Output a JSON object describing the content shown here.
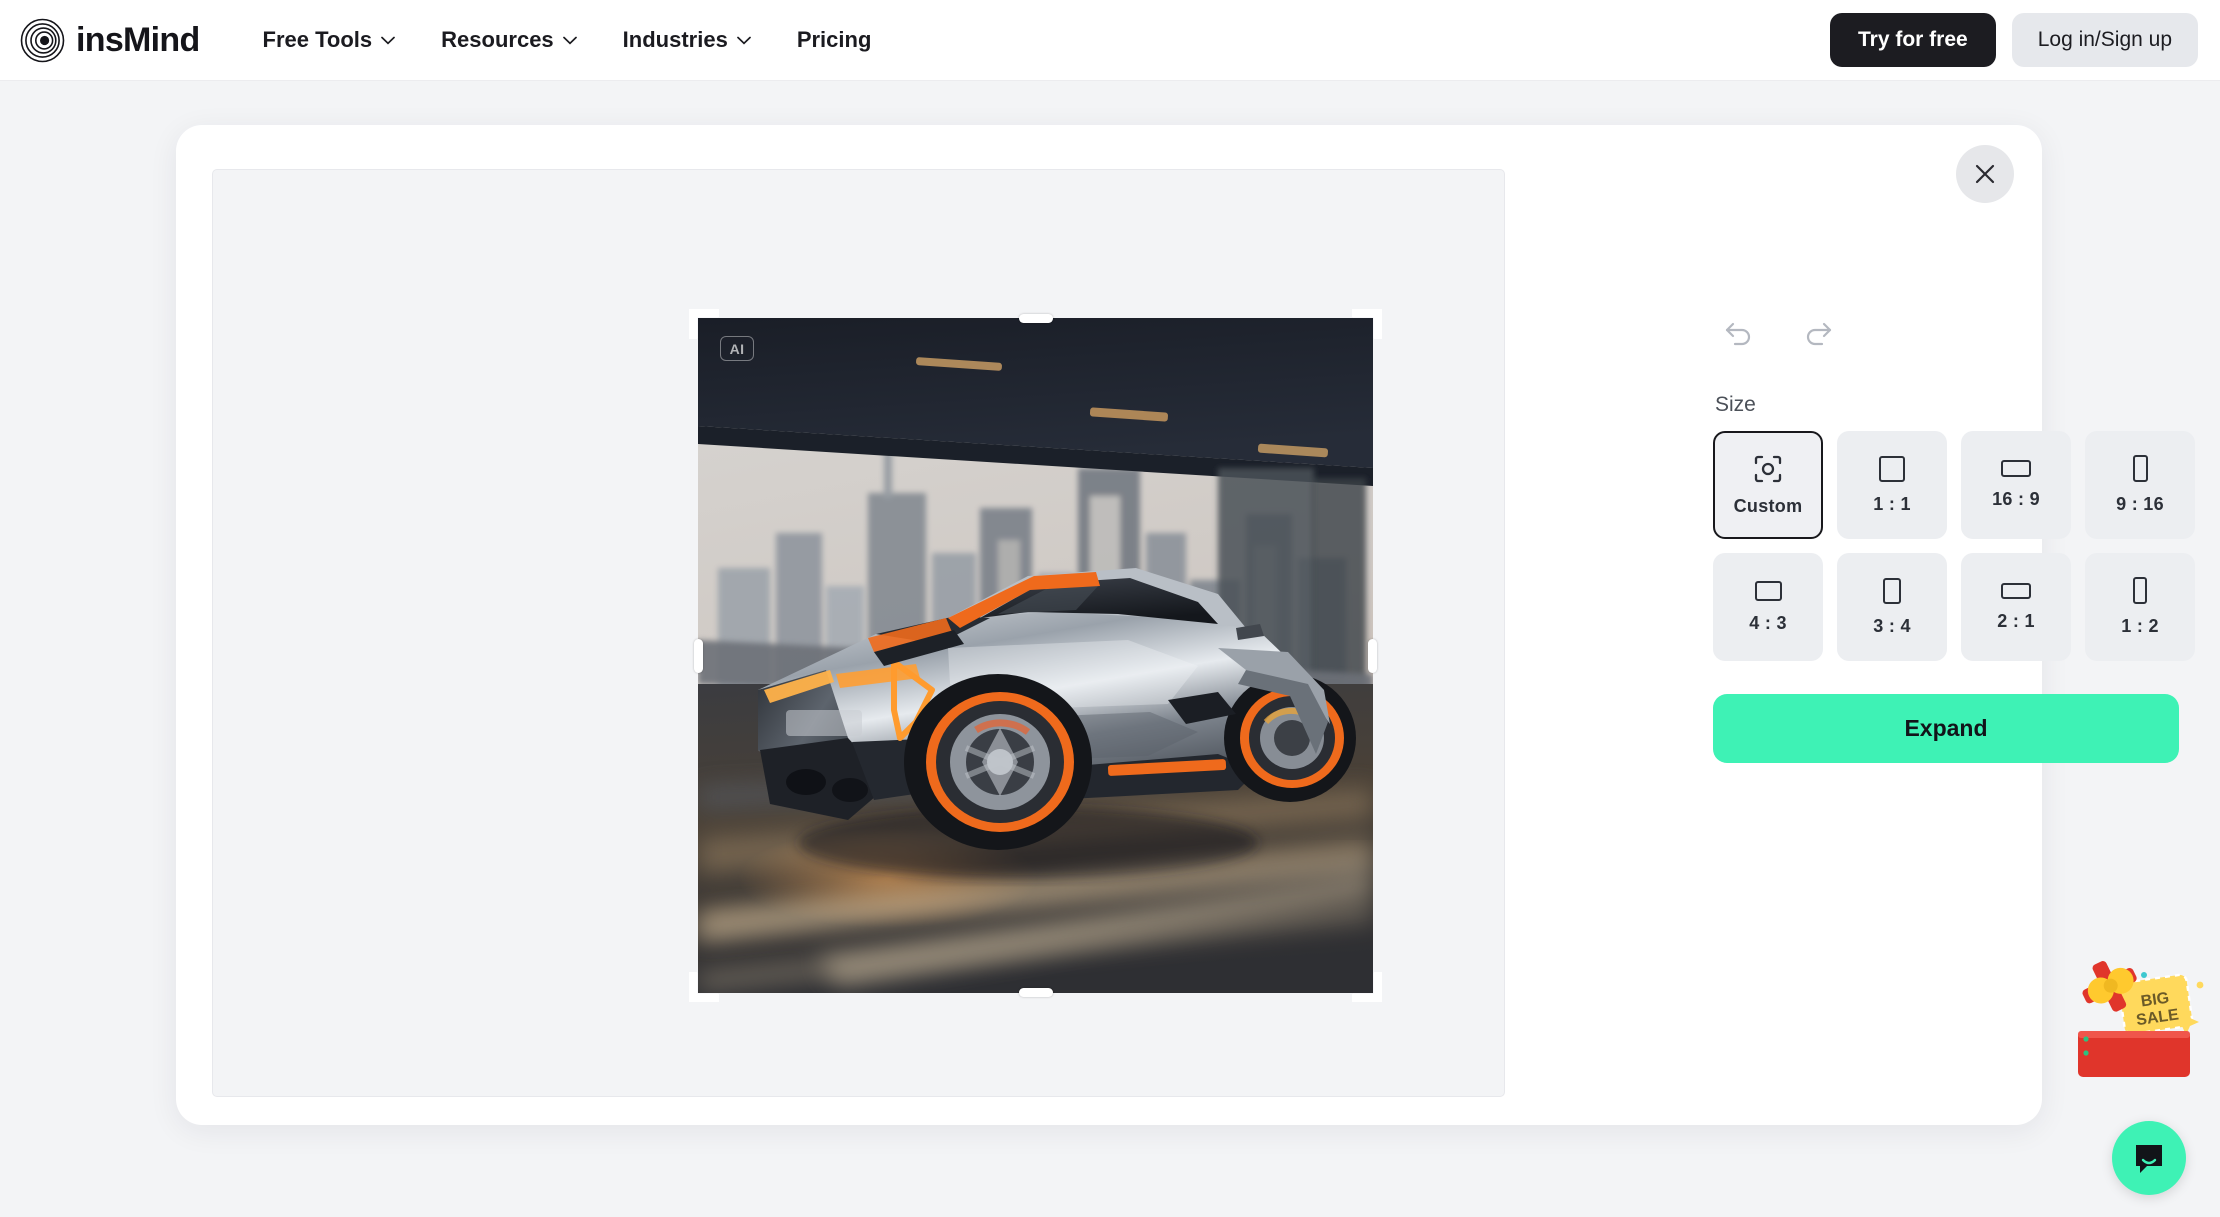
{
  "header": {
    "brand": "insMind",
    "brand_icon": "concentric-circles-logo",
    "nav": [
      {
        "label": "Free Tools",
        "has_dropdown": true
      },
      {
        "label": "Resources",
        "has_dropdown": true
      },
      {
        "label": "Industries",
        "has_dropdown": true
      },
      {
        "label": "Pricing",
        "has_dropdown": false
      }
    ],
    "try_free_label": "Try for free",
    "login_label": "Log in/Sign up"
  },
  "modal": {
    "close_icon": "close-x-icon"
  },
  "canvas": {
    "image_badge": "AI",
    "image_alt": "silver sports car with orange accents driving on city highway at dusk"
  },
  "panel": {
    "undo_icon": "undo-arrow-icon",
    "redo_icon": "redo-arrow-icon",
    "size_label": "Size",
    "sizes": [
      {
        "label": "Custom",
        "icon": "crop-focus-icon",
        "selected": true
      },
      {
        "label": "1 : 1",
        "icon": "square-icon",
        "selected": false
      },
      {
        "label": "16 : 9",
        "icon": "landscape-wide-icon",
        "selected": false
      },
      {
        "label": "9 : 16",
        "icon": "portrait-tall-icon",
        "selected": false
      },
      {
        "label": "4 : 3",
        "icon": "landscape-icon",
        "selected": false
      },
      {
        "label": "3 : 4",
        "icon": "portrait-icon",
        "selected": false
      },
      {
        "label": "2 : 1",
        "icon": "landscape-wide-icon",
        "selected": false
      },
      {
        "label": "1 : 2",
        "icon": "portrait-tall-icon",
        "selected": false
      }
    ],
    "expand_label": "Expand"
  },
  "widgets": {
    "promo_text": "BIG SALE",
    "promo_icon": "gift-box-sale-icon",
    "chat_icon": "chat-bubble-icon"
  },
  "colors": {
    "accent": "#3ef2b5",
    "dark": "#1c1c21",
    "page_bg": "#f3f4f6",
    "panel_cell": "#eceef1"
  }
}
